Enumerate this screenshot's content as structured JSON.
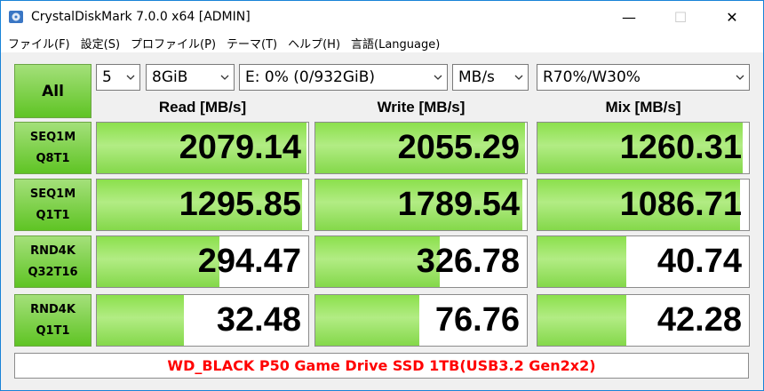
{
  "window": {
    "title": "CrystalDiskMark 7.0.0 x64 [ADMIN]",
    "minimize_glyph": "—",
    "maximize_glyph": "☐",
    "close_glyph": "✕"
  },
  "menu": [
    "ファイル(F)",
    "設定(S)",
    "プロファイル(P)",
    "テーマ(T)",
    "ヘルプ(H)",
    "言語(Language)"
  ],
  "controls": {
    "all_label": "All",
    "count": "5",
    "size": "8GiB",
    "drive": "E: 0% (0/932GiB)",
    "unit": "MB/s",
    "mix": "R70%/W30%"
  },
  "headers": {
    "read": "Read [MB/s]",
    "write": "Write [MB/s]",
    "mix": "Mix [MB/s]"
  },
  "rows": [
    {
      "line1": "SEQ1M",
      "line2": "Q8T1",
      "read": "2079.14",
      "write": "2055.29",
      "mix": "1260.31",
      "read_fill": 0.99,
      "write_fill": 0.99,
      "mix_fill": 0.97
    },
    {
      "line1": "SEQ1M",
      "line2": "Q1T1",
      "read": "1295.85",
      "write": "1789.54",
      "mix": "1086.71",
      "read_fill": 0.97,
      "write_fill": 0.98,
      "mix_fill": 0.96
    },
    {
      "line1": "RND4K",
      "line2": "Q32T16",
      "read": "294.47",
      "write": "326.78",
      "mix": "40.74",
      "read_fill": 0.58,
      "write_fill": 0.59,
      "mix_fill": 0.42
    },
    {
      "line1": "RND4K",
      "line2": "Q1T1",
      "read": "32.48",
      "write": "76.76",
      "mix": "42.28",
      "read_fill": 0.41,
      "write_fill": 0.49,
      "mix_fill": 0.42
    }
  ],
  "comment": "WD_BLACK P50 Game Drive SSD 1TB(USB3.2 Gen2x2)",
  "colors": {
    "accent_green": "#5fc424",
    "bar_green": "#8be04c",
    "comment_red": "#ff0000"
  }
}
